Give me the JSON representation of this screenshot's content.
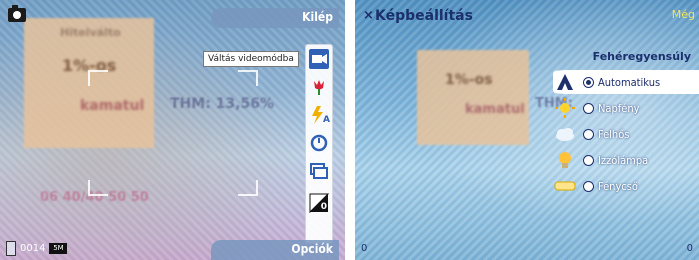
{
  "left": {
    "top_right_softkey": "Kilép",
    "bottom_right_softkey": "Opciók",
    "tooltip": "Váltás videomódba",
    "photo_counter": "0014",
    "memory_label": "5M",
    "flash_badge": "A",
    "exposure_badge": "0",
    "background_text": [
      "Hitelválto",
      "1%-os",
      "kamatul",
      "THM: 13,56%",
      "06 40/40 50 50"
    ],
    "toolbar_icons": [
      "video-mode-icon",
      "scene-tulip-icon",
      "flash-auto-icon",
      "self-timer-icon",
      "sequence-mode-icon",
      "exposure-icon"
    ]
  },
  "right": {
    "title": "Képbeállítás",
    "title_truncated": "Még",
    "section_header": "Fehéregyensúly",
    "options": [
      {
        "label": "Automatikus",
        "icon": "auto-wb-icon",
        "selected": true
      },
      {
        "label": "Napfény",
        "icon": "sun-icon",
        "selected": false
      },
      {
        "label": "Felhős",
        "icon": "cloud-icon",
        "selected": false
      },
      {
        "label": "Izzólámpa",
        "icon": "bulb-icon",
        "selected": false
      },
      {
        "label": "Fénycső",
        "icon": "fluorescent-icon",
        "selected": false
      }
    ],
    "corner_left": "0",
    "corner_right": "0",
    "background_text": [
      "1%-os",
      "kamatul",
      "THM:"
    ]
  },
  "colors": {
    "accent": "#2f61b6",
    "title_text": "#1b2f6d",
    "softkey_bar": "#7896be"
  }
}
